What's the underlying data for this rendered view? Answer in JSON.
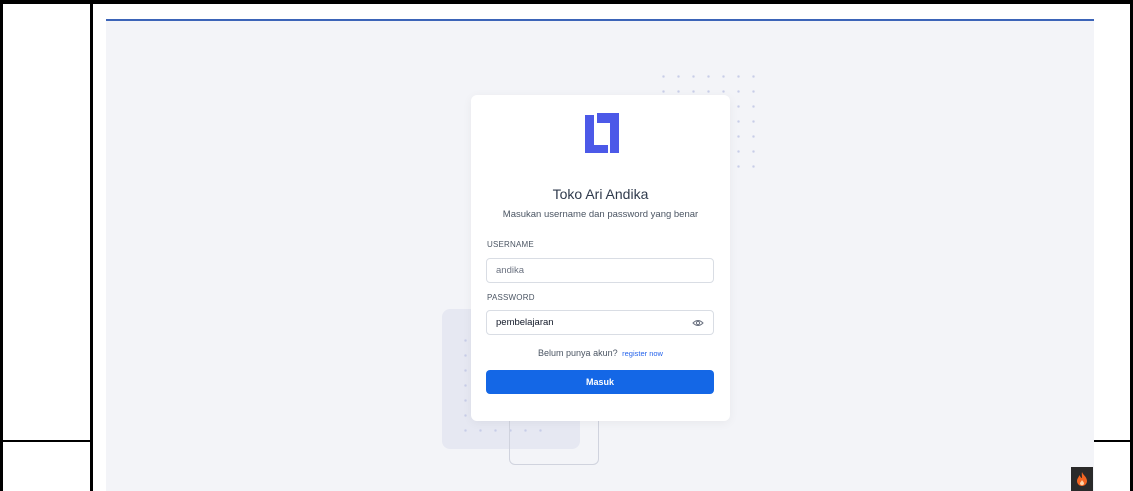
{
  "app": {
    "title": "Toko Ari Andika",
    "subtitle": "Masukan username dan password yang benar"
  },
  "form": {
    "username_label": "USERNAME",
    "username_value": "andika",
    "password_label": "PASSWORD",
    "password_value": "pembelajaran",
    "register_prompt": "Belum punya akun?",
    "register_link": "register now",
    "submit_label": "Masuk"
  },
  "colors": {
    "accent": "#1467e6",
    "logo": "#4c59e8",
    "background": "#f3f4f8"
  },
  "icons": {
    "logo": "brand-logo-icon",
    "password_toggle": "eye-icon",
    "debug_badge": "flame-icon"
  }
}
